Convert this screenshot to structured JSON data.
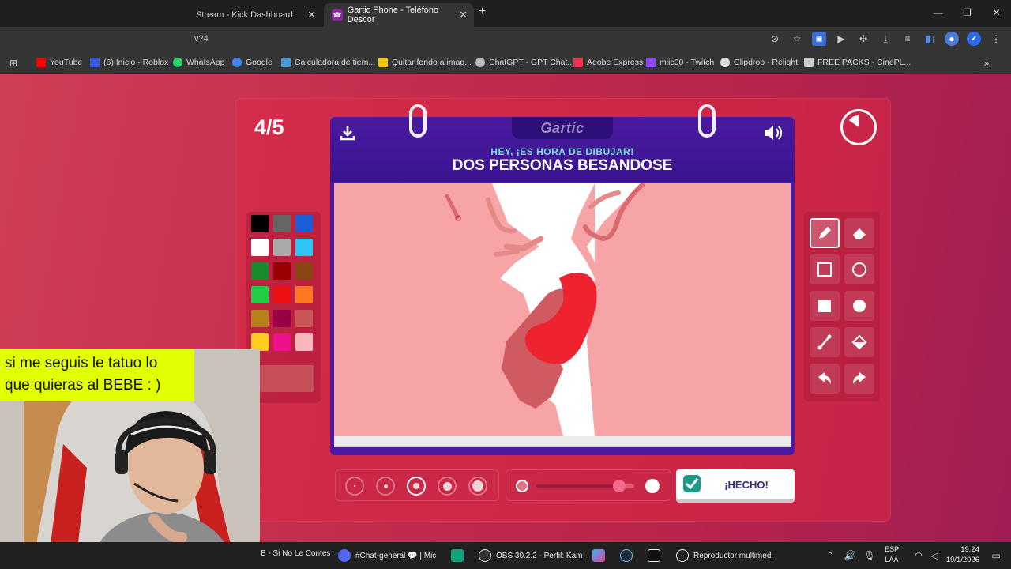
{
  "browser": {
    "tabs": [
      {
        "title": "Stream - Kick Dashboard"
      },
      {
        "title": "Gartic Phone - Teléfono Descor"
      }
    ],
    "url_fragment": "v?4",
    "bookmarks": [
      {
        "label": "YouTube",
        "color": "#ff0000"
      },
      {
        "label": "(6) Inicio - Roblox",
        "color": "#3b5bdb"
      },
      {
        "label": "WhatsApp",
        "color": "#25d366"
      },
      {
        "label": "Google",
        "color": "#4285f4"
      },
      {
        "label": "Calculadora de tiem...",
        "color": "#4a9ad4"
      },
      {
        "label": "Quitar fondo a imag...",
        "color": "#f5c518"
      },
      {
        "label": "ChatGPT - GPT Chat...",
        "color": "#bbbbbb"
      },
      {
        "label": "Adobe Express",
        "color": "#e8344e"
      },
      {
        "label": "miic00 - Twitch",
        "color": "#9146ff"
      },
      {
        "label": "Clipdrop - Relight",
        "color": "#dddddd"
      },
      {
        "label": "FREE PACKS - CinePL...",
        "color": "#cccccc"
      }
    ]
  },
  "game": {
    "round": "4/5",
    "logo": "Gartic",
    "prompt_hint": "HEY, ¡ES HORA DE DIBUJAR!",
    "prompt_word": "DOS PERSONAS BESANDOSE",
    "done_label": "¡HECHO!",
    "timer_elapsed_fraction": 0.15,
    "palette": [
      "#000000",
      "#666666",
      "#1a5fd6",
      "#ffffff",
      "#aaaaaa",
      "#2ec5f4",
      "#1b8a2e",
      "#990000",
      "#8b4513",
      "#22cc44",
      "#ee1111",
      "#ff7722",
      "#b8801a",
      "#990044",
      "#c85858",
      "#ffcc22",
      "#ee1188",
      "#f7b7bb"
    ],
    "current_color": "#c8505a",
    "tools": [
      "pencil",
      "eraser",
      "rectangle-outline",
      "circle-outline",
      "rectangle-filled",
      "circle-filled",
      "line",
      "fill-bucket",
      "undo",
      "redo"
    ],
    "selected_tool": "pencil",
    "brush_sizes": 5,
    "selected_brush_size": 3,
    "opacity_fraction": 0.85
  },
  "stream_overlay": {
    "caption_line1": "si me seguis le tatuo lo",
    "caption_line2": "que quieras al BEBE : )"
  },
  "taskbar": {
    "items": [
      {
        "label": "B - Si No Le Contes"
      },
      {
        "label": "#Chat-general 💬 | Mic"
      },
      {
        "label": "OBS 30.2.2 - Perfil: Kam"
      },
      {
        "label": "Reproductor multimedi"
      }
    ],
    "lang_line1": "ESP",
    "lang_line2": "LAA",
    "time": "19:24",
    "date": "19/1/2026"
  }
}
